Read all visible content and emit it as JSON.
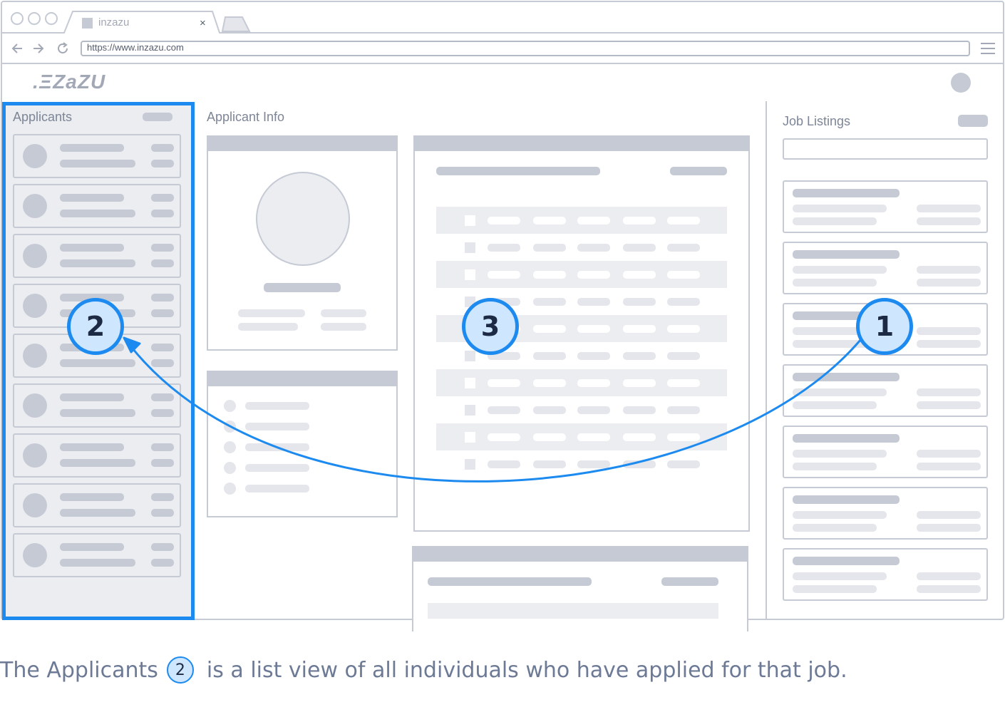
{
  "browser": {
    "tab_title": "inzazu",
    "tab_close": "×",
    "url": "https://www.inzazu.com"
  },
  "app": {
    "logo": ".ΞZaZU"
  },
  "panels": {
    "applicants": {
      "title": "Applicants"
    },
    "applicant_info": {
      "title": "Applicant Info"
    },
    "job_listings": {
      "title": "Job Listings",
      "search_placeholder": ""
    }
  },
  "callouts": [
    {
      "number": "2"
    },
    {
      "number": "3"
    },
    {
      "number": "1"
    }
  ],
  "caption": {
    "before": "The Applicants",
    "badge": "2",
    "after": "is a list view of all individuals who have applied for that job."
  },
  "colors": {
    "accent": "#1d8af0",
    "badge_fill": "#cfe6ff",
    "skeleton": "#c5cad5",
    "skeleton_light": "#e4e6eb",
    "panel_bg": "#ebedf1"
  }
}
